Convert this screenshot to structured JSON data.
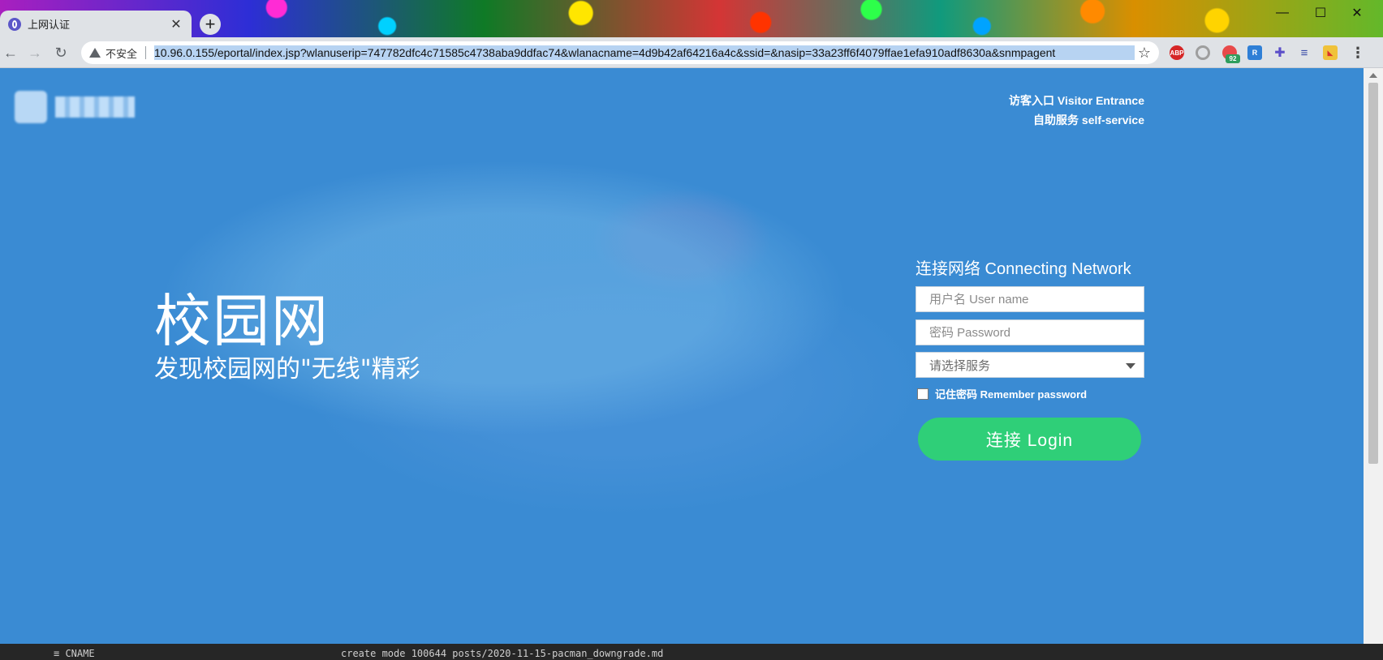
{
  "browser": {
    "tab_title": "上网认证",
    "tab_close": "✕",
    "new_tab": "+",
    "window_controls": [
      "—",
      "☐",
      "✕"
    ],
    "security_label": "不安全",
    "url": "10.96.0.155/eportal/index.jsp?wlanuserip=747782dfc4c71585c4738aba9ddfac74&wlanacname=4d9b42af64216a4c&ssid=&nasip=33a23ff6f4079ffae1efa910adf8630a&snmpagent",
    "extension_badge": "92",
    "extension_abp": "ABP"
  },
  "page": {
    "top_links": {
      "visitor": "访客入口 Visitor Entrance",
      "self_service": "自助服务 self-service"
    },
    "slogan": {
      "title": "校园网",
      "subtitle": "发现校园网的\"无线\"精彩"
    },
    "login": {
      "title": "连接网络 Connecting Network",
      "username_placeholder": "用户名 User name",
      "password_placeholder": "密码 Password",
      "service_placeholder": "请选择服务",
      "remember_label": "记住密码 Remember password",
      "login_button": "连接 Login"
    }
  },
  "background_window": {
    "left_text": "≡ CNAME",
    "right_text": "create mode 100644  posts/2020-11-15-pacman_downgrade.md"
  },
  "colors": {
    "page_background": "#3a8bd3",
    "login_button": "#2fcf78"
  }
}
